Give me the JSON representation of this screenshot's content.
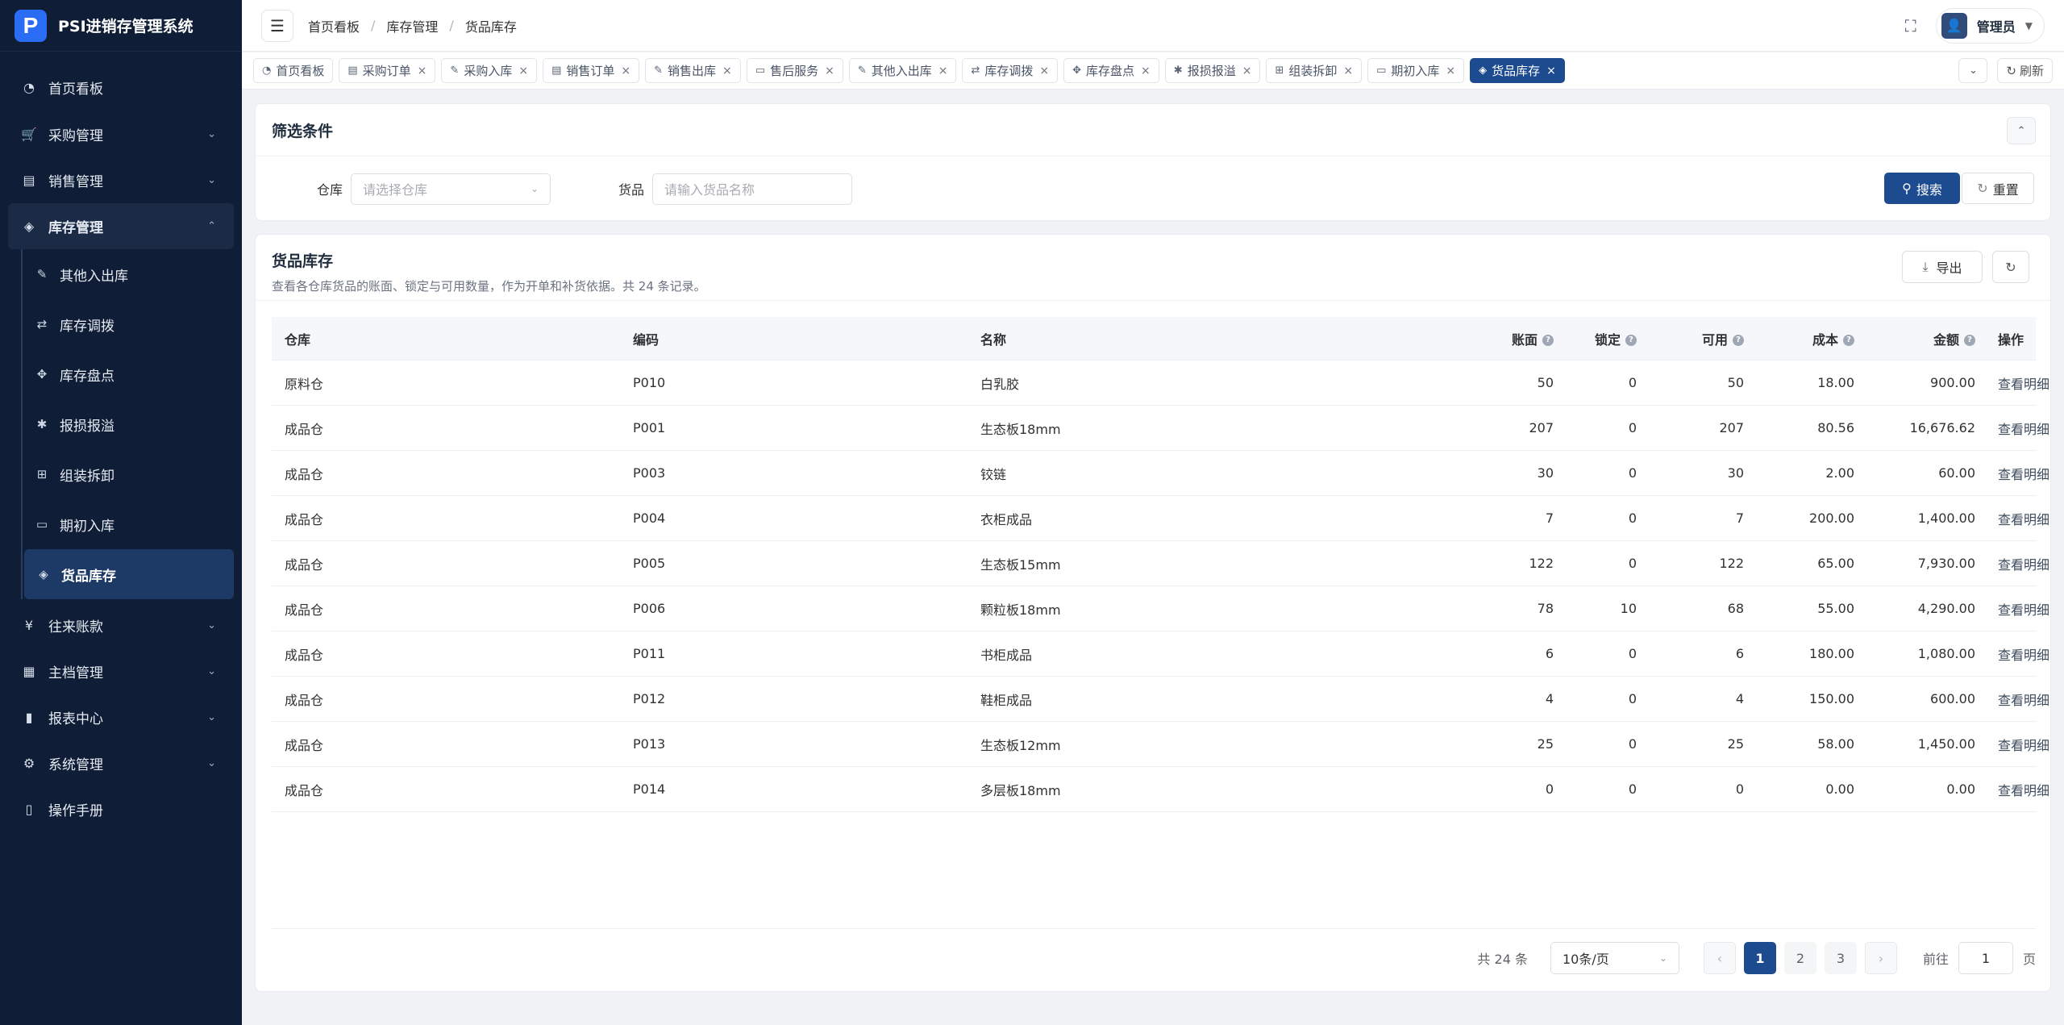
{
  "app": {
    "title": "PSI进销存管理系统",
    "logo_letter": "P"
  },
  "sidebar": {
    "items": [
      {
        "label": "首页看板",
        "icon": "dashboard-icon",
        "glyph": "◔"
      },
      {
        "label": "采购管理",
        "icon": "cart-icon",
        "glyph": "🛒"
      },
      {
        "label": "销售管理",
        "icon": "document-icon",
        "glyph": "▤"
      },
      {
        "label": "库存管理",
        "icon": "layers-icon",
        "glyph": "◈"
      },
      {
        "label": "往来账款",
        "icon": "yen-icon",
        "glyph": "¥"
      },
      {
        "label": "主档管理",
        "icon": "database-icon",
        "glyph": "▦"
      },
      {
        "label": "报表中心",
        "icon": "bar-chart-icon",
        "glyph": "▮"
      },
      {
        "label": "系统管理",
        "icon": "gear-icon",
        "glyph": "⚙"
      },
      {
        "label": "操作手册",
        "icon": "book-icon",
        "glyph": "▯"
      }
    ],
    "inventory_sub": [
      {
        "label": "其他入出库",
        "icon": "edit-icon",
        "glyph": "✎"
      },
      {
        "label": "库存调拨",
        "icon": "transfer-icon",
        "glyph": "⇄"
      },
      {
        "label": "库存盘点",
        "icon": "target-icon",
        "glyph": "✥"
      },
      {
        "label": "报损报溢",
        "icon": "bug-icon",
        "glyph": "✱"
      },
      {
        "label": "组装拆卸",
        "icon": "grid-icon",
        "glyph": "⊞"
      },
      {
        "label": "期初入库",
        "icon": "calendar-icon",
        "glyph": "▭"
      },
      {
        "label": "货品库存",
        "icon": "layers-icon",
        "glyph": "◈"
      }
    ]
  },
  "header": {
    "breadcrumb": [
      "首页看板",
      "库存管理",
      "货品库存"
    ],
    "breadcrumb_sep": "/",
    "user_name": "管理员"
  },
  "tabs": [
    {
      "label": "首页看板",
      "icon": "dashboard-icon",
      "glyph": "◔",
      "closable": false
    },
    {
      "label": "采购订单",
      "icon": "document-icon",
      "glyph": "▤",
      "closable": true
    },
    {
      "label": "采购入库",
      "icon": "edit-icon",
      "glyph": "✎",
      "closable": true
    },
    {
      "label": "销售订单",
      "icon": "document-icon",
      "glyph": "▤",
      "closable": true
    },
    {
      "label": "销售出库",
      "icon": "edit-icon",
      "glyph": "✎",
      "closable": true
    },
    {
      "label": "售后服务",
      "icon": "briefcase-icon",
      "glyph": "▭",
      "closable": true
    },
    {
      "label": "其他入出库",
      "icon": "edit-icon",
      "glyph": "✎",
      "closable": true
    },
    {
      "label": "库存调拨",
      "icon": "transfer-icon",
      "glyph": "⇄",
      "closable": true
    },
    {
      "label": "库存盘点",
      "icon": "target-icon",
      "glyph": "✥",
      "closable": true
    },
    {
      "label": "报损报溢",
      "icon": "bug-icon",
      "glyph": "✱",
      "closable": true
    },
    {
      "label": "组装拆卸",
      "icon": "grid-icon",
      "glyph": "⊞",
      "closable": true
    },
    {
      "label": "期初入库",
      "icon": "calendar-icon",
      "glyph": "▭",
      "closable": true
    },
    {
      "label": "货品库存",
      "icon": "layers-icon",
      "glyph": "◈",
      "closable": true,
      "active": true
    }
  ],
  "tabs_refresh_label": "刷新",
  "filter": {
    "title": "筛选条件",
    "warehouse_label": "仓库",
    "warehouse_placeholder": "请选择仓库",
    "goods_label": "货品",
    "goods_placeholder": "请输入货品名称",
    "search_label": "搜索",
    "reset_label": "重置"
  },
  "data": {
    "title": "货品库存",
    "desc": "查看各仓库货品的账面、锁定与可用数量，作为开单和补货依据。共 24 条记录。",
    "export_label": "导出",
    "columns": {
      "warehouse": "仓库",
      "code": "编码",
      "name": "名称",
      "book": "账面",
      "locked": "锁定",
      "available": "可用",
      "cost": "成本",
      "amount": "金额",
      "action": "操作"
    },
    "action_label": "查看明细",
    "rows": [
      {
        "warehouse": "原料仓",
        "code": "P010",
        "name": "白乳胶",
        "book": "50",
        "locked": "0",
        "available": "50",
        "cost": "18.00",
        "amount": "900.00"
      },
      {
        "warehouse": "成品仓",
        "code": "P001",
        "name": "生态板18mm",
        "book": "207",
        "locked": "0",
        "available": "207",
        "cost": "80.56",
        "amount": "16,676.62"
      },
      {
        "warehouse": "成品仓",
        "code": "P003",
        "name": "铰链",
        "book": "30",
        "locked": "0",
        "available": "30",
        "cost": "2.00",
        "amount": "60.00"
      },
      {
        "warehouse": "成品仓",
        "code": "P004",
        "name": "衣柜成品",
        "book": "7",
        "locked": "0",
        "available": "7",
        "cost": "200.00",
        "amount": "1,400.00"
      },
      {
        "warehouse": "成品仓",
        "code": "P005",
        "name": "生态板15mm",
        "book": "122",
        "locked": "0",
        "available": "122",
        "cost": "65.00",
        "amount": "7,930.00"
      },
      {
        "warehouse": "成品仓",
        "code": "P006",
        "name": "颗粒板18mm",
        "book": "78",
        "locked": "10",
        "available": "68",
        "cost": "55.00",
        "amount": "4,290.00"
      },
      {
        "warehouse": "成品仓",
        "code": "P011",
        "name": "书柜成品",
        "book": "6",
        "locked": "0",
        "available": "6",
        "cost": "180.00",
        "amount": "1,080.00"
      },
      {
        "warehouse": "成品仓",
        "code": "P012",
        "name": "鞋柜成品",
        "book": "4",
        "locked": "0",
        "available": "4",
        "cost": "150.00",
        "amount": "600.00"
      },
      {
        "warehouse": "成品仓",
        "code": "P013",
        "name": "生态板12mm",
        "book": "25",
        "locked": "0",
        "available": "25",
        "cost": "58.00",
        "amount": "1,450.00"
      },
      {
        "warehouse": "成品仓",
        "code": "P014",
        "name": "多层板18mm",
        "book": "0",
        "locked": "0",
        "available": "0",
        "cost": "0.00",
        "amount": "0.00"
      }
    ]
  },
  "pagination": {
    "total_text": "共 24 条",
    "page_size": "10条/页",
    "pages": [
      "1",
      "2",
      "3"
    ],
    "current": "1",
    "goto_label": "前往",
    "goto_value": "1",
    "page_suffix": "页"
  },
  "colors": {
    "primary": "#1d4b8f",
    "sidebar_bg": "#0f1e36",
    "page_bg": "#f0f2f5"
  }
}
